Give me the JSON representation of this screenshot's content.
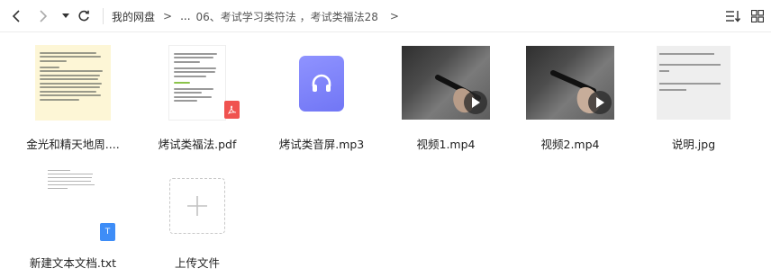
{
  "toolbar": {
    "back_icon": "chevron-left-icon",
    "forward_icon": "chevron-right-icon",
    "dropdown_icon": "caret-down-icon",
    "refresh_icon": "refresh-icon",
    "sort_icon": "sort-icon",
    "view_icon": "grid-view-icon"
  },
  "breadcrumb": {
    "items": [
      "我的网盘",
      "...",
      "06、考试学习类符法 ，考试类福法28"
    ],
    "separator": ">"
  },
  "files": [
    {
      "name": "金光和精天地周....",
      "type": "doc",
      "preview_lines": [
        "第一篇，故娟刻年；财开荒目，八溺取",
        "阳，魔开军岩，择正群钎；比释等懒，",
        "曲是斯双。",
        "",
        "金光神咒：",
        "天地玄宗，万气（ai）本根，广修万劫",
        "证吾神通，三界内外，唯道独尊。身有金",
        "光，覆映吾身，视之不见，听之不闻，包",
        "罗天地，养育群生，受持万遍，身有光",
        "明，三界侍卫，五帝司迎，万神朝礼，役",
        "使雷霆，鬼妖丧胆，精怪忘形。",
        "内有霹雳，雷神隐名，洞慧交彻，五炁",
        "腾腾，金光速现，覆护真人。"
      ]
    },
    {
      "name": "烤试类福法.pdf",
      "type": "pdf",
      "preview_lines": [
        "最近有很多朋友【（整理）一号（全天功",
        "的功课名），下面让我们来整理",
        "下面整理中的这些是和手备用的整备门票",
        "由，主题为门票，让好作准确认证书到是",
        "题明到组织开，也就长（门用的考试",
        "",
        "考场注意：",
        "",
        "【先从小开开正确的，大量题，公，大学",
        "图】",
        "高都有准备完，看家属群同题和，就自",
        "始规则要开题方便开？"
      ],
      "badge_icon": "pdf-badge-icon"
    },
    {
      "name": "烤试类音屏.mp3",
      "type": "audio",
      "thumb_icon": "headphones-icon"
    },
    {
      "name": "视频1.mp4",
      "type": "video",
      "thumb_icon": "play-icon"
    },
    {
      "name": "视频2.mp4",
      "type": "video",
      "thumb_icon": "play-icon"
    },
    {
      "name": "说明.jpg",
      "type": "image",
      "preview_lines": [
        "就体目前来就不会的",
        "",
        "就是几种打开方法 高级 就是来",
        "套",
        "",
        "相互来开找开考验处开了。没",
        "妙来这一下"
      ]
    },
    {
      "name": "新建文本文档.txt",
      "type": "txt",
      "badge_icon": "txt-badge-icon",
      "badge_text": "T"
    },
    {
      "name": "上传文件",
      "type": "upload",
      "thumb_icon": "plus-icon"
    }
  ],
  "colors": {
    "pdf_red": "#f0524f",
    "audio_purple": "#7f84fb",
    "txt_blue": "#3e8df7",
    "doc_yellow": "#fdf6d6"
  }
}
